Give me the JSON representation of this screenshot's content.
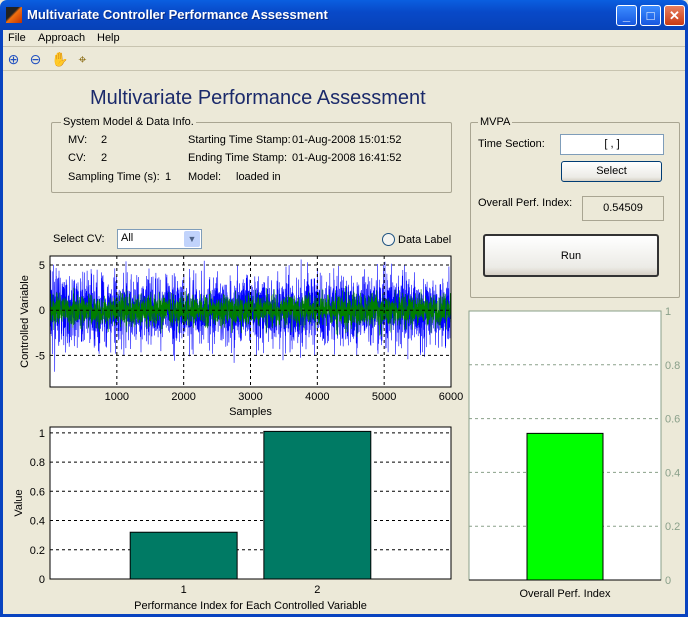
{
  "window": {
    "title": "Multivariate Controller Performance Assessment",
    "controls": [
      "minimize",
      "maximize",
      "close"
    ]
  },
  "menu": [
    {
      "label": "File"
    },
    {
      "label": "Approach"
    },
    {
      "label": "Help"
    }
  ],
  "toolbar": [
    {
      "icon": "zoom-in-icon"
    },
    {
      "icon": "zoom-out-icon"
    },
    {
      "icon": "pan-hand-icon"
    },
    {
      "icon": "data-cursor-icon"
    }
  ],
  "heading": "Multivariate Performance Assessment",
  "info": {
    "title": "System Model & Data Info.",
    "mv_label": "MV:",
    "mv": "2",
    "cv_label": "CV:",
    "cv": "2",
    "sampling_label": "Sampling Time (s):",
    "sampling": "1",
    "start_label": "Starting Time Stamp:",
    "start": "01-Aug-2008 15:01:52",
    "end_label": "Ending Time Stamp:",
    "end": "01-Aug-2008 16:41:52",
    "model_label": "Model:",
    "model": "loaded in"
  },
  "mvpa": {
    "title": "MVPA",
    "time_section_label": "Time Section:",
    "time_section_value": "[ , ]",
    "select_label": "Select",
    "overall_label": "Overall Perf. Index:",
    "overall_value": "0.54509",
    "run_label": "Run"
  },
  "select_cv": {
    "label": "Select CV:",
    "value": "All"
  },
  "data_label_radio": {
    "label": "Data Label",
    "checked": false
  },
  "chart_data": [
    {
      "type": "line",
      "xlabel": "Samples",
      "ylabel": "Controlled Variable",
      "xlim": [
        0,
        6000
      ],
      "ylim": [
        -8.5,
        6
      ],
      "xticks": [
        1000,
        2000,
        3000,
        4000,
        5000,
        6000
      ],
      "yticks": [
        -5,
        0,
        5
      ],
      "grid": true,
      "series": [
        {
          "color": "#0000FF",
          "mean": 0,
          "approx_range": [
            -8,
            6
          ]
        },
        {
          "color": "#007F00",
          "mean": 0,
          "approx_range": [
            -3,
            3
          ]
        }
      ]
    },
    {
      "type": "bar",
      "xlabel": "Performance Index for Each Controlled Variable",
      "ylabel": "Value",
      "categories": [
        "1",
        "2"
      ],
      "values": [
        0.32,
        1.01
      ],
      "ylim": [
        0,
        1.04
      ],
      "yticks": [
        0,
        0.2,
        0.4,
        0.6,
        0.8,
        1
      ],
      "grid": true,
      "color": "#007A64"
    },
    {
      "type": "bar",
      "xlabel": "Overall Perf. Index",
      "categories": [
        ""
      ],
      "values": [
        0.54509
      ],
      "ylim": [
        0,
        1
      ],
      "yticks": [
        0,
        0.2,
        0.4,
        0.6,
        0.8,
        1
      ],
      "yaxis": "right",
      "grid": true,
      "color": "#00FF00"
    }
  ]
}
